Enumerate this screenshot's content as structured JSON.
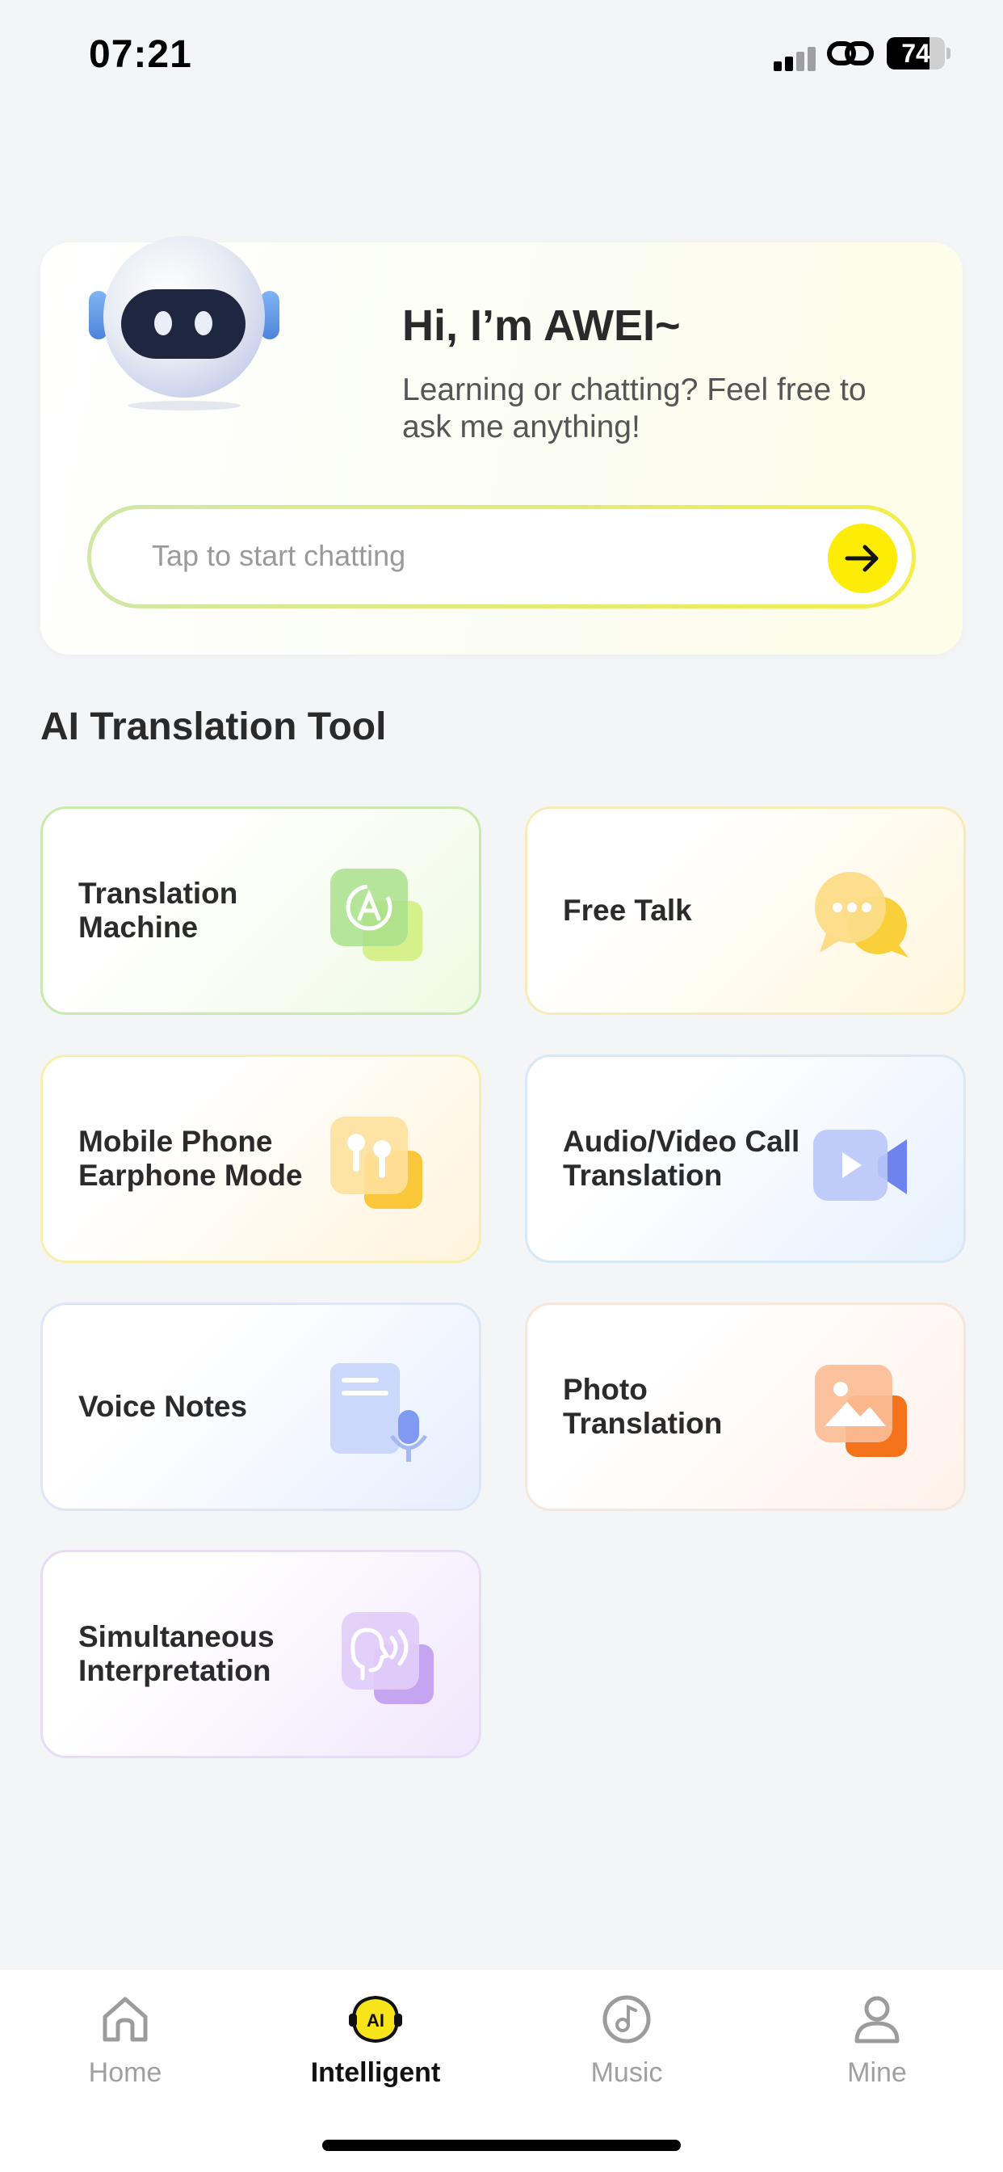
{
  "status_bar": {
    "time": "07:21",
    "battery": "74",
    "battery_level": 0.74
  },
  "hero": {
    "title": "Hi, I’m AWEI~",
    "subtitle": "Learning or chatting? Feel free to ask me anything!",
    "chat_placeholder": "Tap to start chatting"
  },
  "section": {
    "title": "AI Translation Tool"
  },
  "tools": [
    {
      "label": "Translation Machine",
      "icon": "translate-icon"
    },
    {
      "label": "Free Talk",
      "icon": "chat-bubbles-icon"
    },
    {
      "label": "Mobile Phone Earphone Mode",
      "icon": "earbuds-icon"
    },
    {
      "label": "Audio/Video Call Translation",
      "icon": "video-call-icon"
    },
    {
      "label": "Voice Notes",
      "icon": "voice-notes-icon"
    },
    {
      "label": "Photo Translation",
      "icon": "photo-icon"
    },
    {
      "label": "Simultaneous Interpretation",
      "icon": "interpretation-icon"
    }
  ],
  "tabs": [
    {
      "label": "Home",
      "icon": "home-icon"
    },
    {
      "label": "Intelligent",
      "icon": "ai-icon",
      "active": true
    },
    {
      "label": "Music",
      "icon": "music-icon"
    },
    {
      "label": "Mine",
      "icon": "profile-icon"
    }
  ]
}
